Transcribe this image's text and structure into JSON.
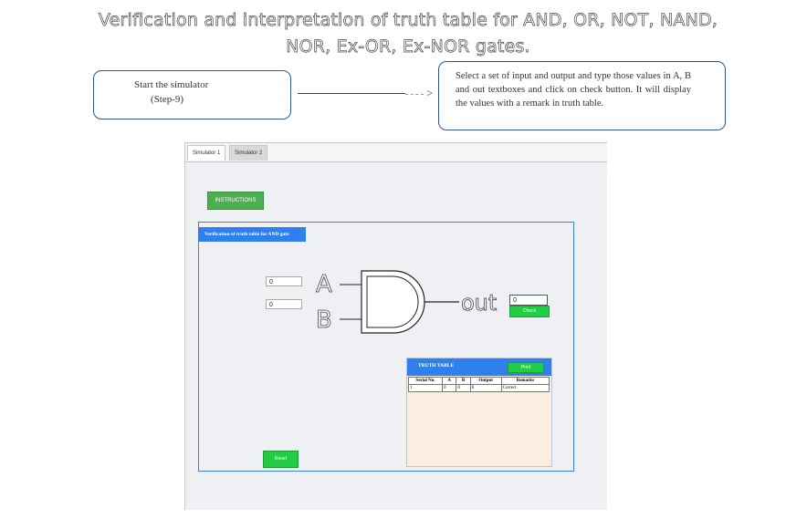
{
  "heading": {
    "line1": "Verification and interpretation of truth table for AND, OR, NOT, NAND,",
    "line2": "NOR, Ex-OR, Ex-NOR gates."
  },
  "step_bubble": {
    "line1": "Start the simulator",
    "line2": "(Step-9)"
  },
  "instruction_bubble": {
    "text": "Select a set of input and output and type those values in A, B and out textboxes and click on check button. It will display the values with a remark in truth table."
  },
  "connector_arrow": ">",
  "tabs": [
    {
      "label": "Simulator 1",
      "active": true
    },
    {
      "label": "Simulator 2",
      "active": false
    }
  ],
  "instructions_button": "INSTRUCTIONS",
  "panel": {
    "title": "Verification of truth table for AND gate"
  },
  "inputs": {
    "a_value": "0",
    "b_value": "0",
    "out_value": "0"
  },
  "gate": {
    "label_a": "A",
    "label_b": "B",
    "label_out": "out"
  },
  "check_button": "Check",
  "truth_table": {
    "title": "TRUTH TABLE",
    "print_button": "Print",
    "columns": [
      "Serial No.",
      "A",
      "B",
      "Output",
      "Remarks"
    ],
    "rows": [
      [
        "1",
        "0",
        "0",
        "0",
        "Correct"
      ]
    ]
  },
  "reset_button": "Reset",
  "colors": {
    "accent_blue": "#2f80ed",
    "button_green": "#22cc44",
    "instructions_green": "#4caf50",
    "table_bg": "#fbeee0"
  }
}
